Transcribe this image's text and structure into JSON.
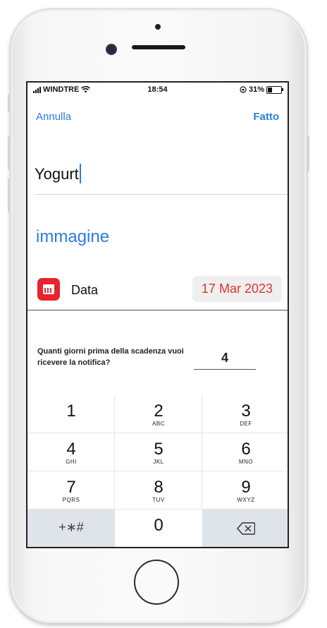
{
  "status_bar": {
    "carrier": "WINDTRE",
    "time": "18:54",
    "battery": "31%"
  },
  "nav": {
    "cancel_label": "Annulla",
    "done_label": "Fatto"
  },
  "product": {
    "name": "Yogurt",
    "image_link": "immagine"
  },
  "date_row": {
    "label": "Data",
    "value": "17 Mar 2023",
    "icon": "calendar-icon",
    "accent": "#e8232b"
  },
  "notification": {
    "question": "Quanti giorni prima della scadenza vuoi ricevere la notifica?",
    "days": "4"
  },
  "keypad": {
    "keys": [
      {
        "num": "1",
        "letters": ""
      },
      {
        "num": "2",
        "letters": "ABC"
      },
      {
        "num": "3",
        "letters": "DEF"
      },
      {
        "num": "4",
        "letters": "GHI"
      },
      {
        "num": "5",
        "letters": "JKL"
      },
      {
        "num": "6",
        "letters": "MNO"
      },
      {
        "num": "7",
        "letters": "PQRS"
      },
      {
        "num": "8",
        "letters": "TUV"
      },
      {
        "num": "9",
        "letters": "WXYZ"
      }
    ],
    "symbols_label": "+∗#",
    "zero": "0",
    "delete_icon": "backspace-icon"
  },
  "colors": {
    "link": "#2a7de1",
    "date_text": "#e0322e"
  }
}
